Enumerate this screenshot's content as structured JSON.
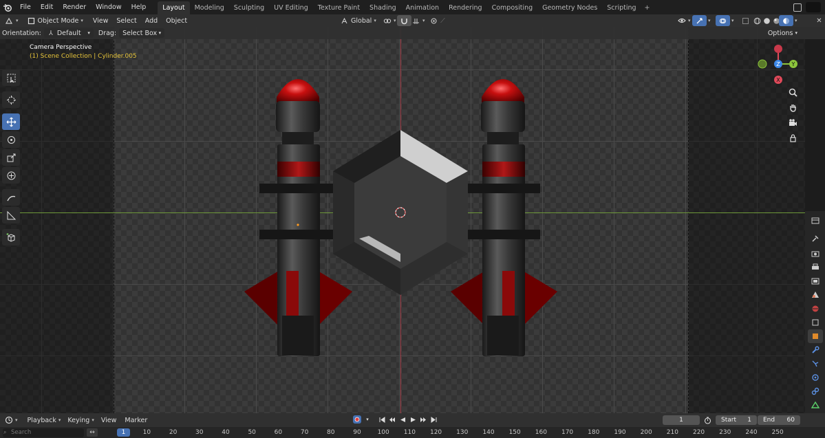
{
  "menubar": {
    "items": [
      "File",
      "Edit",
      "Render",
      "Window",
      "Help"
    ],
    "workspaces": [
      "Layout",
      "Modeling",
      "Sculpting",
      "UV Editing",
      "Texture Paint",
      "Shading",
      "Animation",
      "Rendering",
      "Compositing",
      "Geometry Nodes",
      "Scripting"
    ],
    "active_workspace": "Layout",
    "add_tab": "+"
  },
  "viewport_header": {
    "mode": "Object Mode",
    "menus": [
      "View",
      "Select",
      "Add",
      "Object"
    ],
    "transform_orientation": "Global"
  },
  "tool_settings": {
    "orientation_label": "Orientation:",
    "orientation_value": "Default",
    "drag_label": "Drag:",
    "drag_value": "Select Box",
    "options": "Options"
  },
  "viewport": {
    "camera_label": "Camera Perspective",
    "collection_label": "(1) Scene Collection | Cylinder.005",
    "gizmo_labels": {
      "x": "X",
      "y": "Y",
      "z": "Z"
    }
  },
  "colors": {
    "accent": "#4772b3",
    "x_axis": "#e04a5a",
    "y_axis": "#8cc43c",
    "z_axis": "#3c88e8",
    "info_yellow": "#e6c43a"
  },
  "timeline": {
    "menus": [
      "Playback",
      "Keying",
      "View",
      "Marker"
    ],
    "current_frame": "1",
    "start_label": "Start",
    "start_value": "1",
    "end_label": "End",
    "end_value": "60"
  },
  "ruler": {
    "search_placeholder": "Search",
    "current_frame": "1",
    "ticks": [
      "10",
      "20",
      "30",
      "40",
      "50",
      "60",
      "70",
      "80",
      "90",
      "100",
      "110",
      "120",
      "130",
      "140",
      "150",
      "160",
      "170",
      "180",
      "190",
      "200",
      "210",
      "220",
      "230",
      "240",
      "250"
    ]
  }
}
